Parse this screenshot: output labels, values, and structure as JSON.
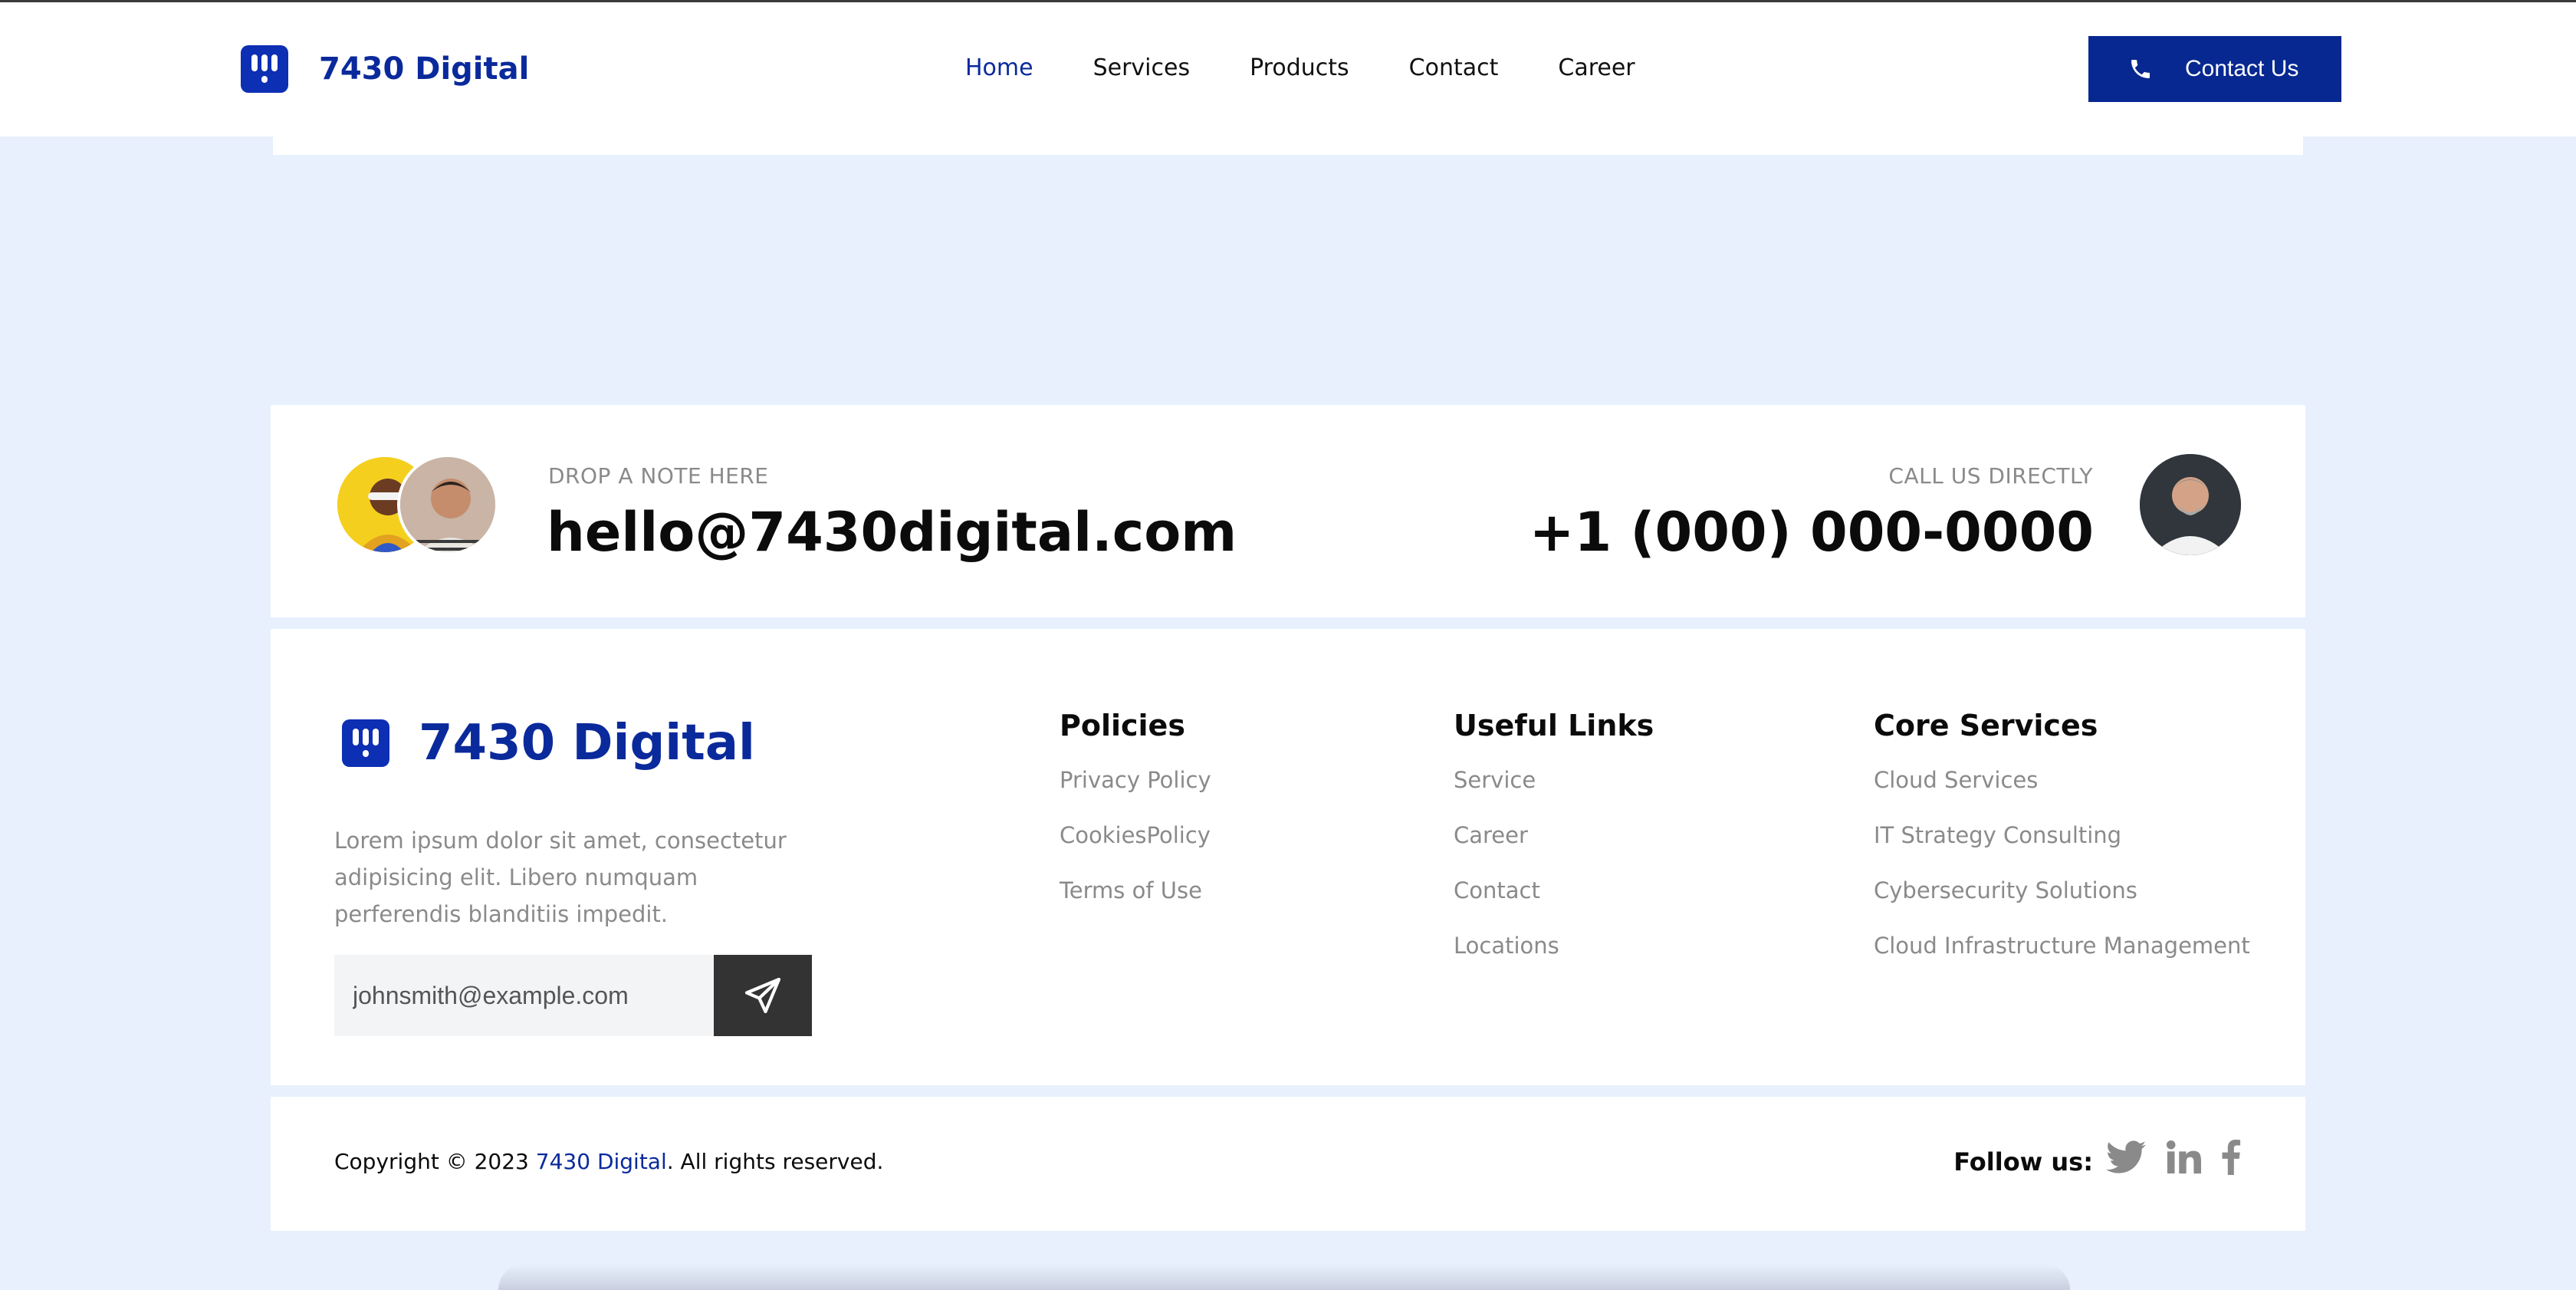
{
  "header": {
    "brand": "7430 Digital",
    "nav": [
      {
        "label": "Home",
        "active": true
      },
      {
        "label": "Services",
        "active": false
      },
      {
        "label": "Products",
        "active": false
      },
      {
        "label": "Contact",
        "active": false
      },
      {
        "label": "Career",
        "active": false
      }
    ],
    "contact_button": "Contact Us",
    "colors": {
      "brand": "#0a2a9c",
      "button": "#082891",
      "page_bg": "#e8f0fe"
    }
  },
  "contact": {
    "note_label": "DROP A NOTE HERE",
    "email": "hello@7430digital.com",
    "call_label": "CALL US DIRECTLY",
    "phone": "+1 (000) 000-0000"
  },
  "footer": {
    "brand": "7430 Digital",
    "description": "Lorem ipsum dolor sit amet, consectetur adipisicing elit. Libero numquam perferendis blanditiis impedit.",
    "subscribe_placeholder": "johnsmith@example.com",
    "columns": [
      {
        "title": "Policies",
        "links": [
          "Privacy Policy",
          "CookiesPolicy",
          "Terms of Use"
        ]
      },
      {
        "title": "Useful Links",
        "links": [
          "Service",
          "Career",
          "Contact",
          "Locations"
        ]
      },
      {
        "title": "Core Services",
        "links": [
          "Cloud Services",
          "IT Strategy Consulting",
          "Cybersecurity Solutions",
          "Cloud Infrastructure Management"
        ]
      }
    ]
  },
  "bottom": {
    "copyright_prefix": "Copyright © 2023 ",
    "copyright_brand": "7430 Digital",
    "copyright_suffix": ". All rights reserved.",
    "follow_label": "Follow us:",
    "socials": [
      "twitter-icon",
      "linkedin-icon",
      "facebook-icon"
    ]
  }
}
